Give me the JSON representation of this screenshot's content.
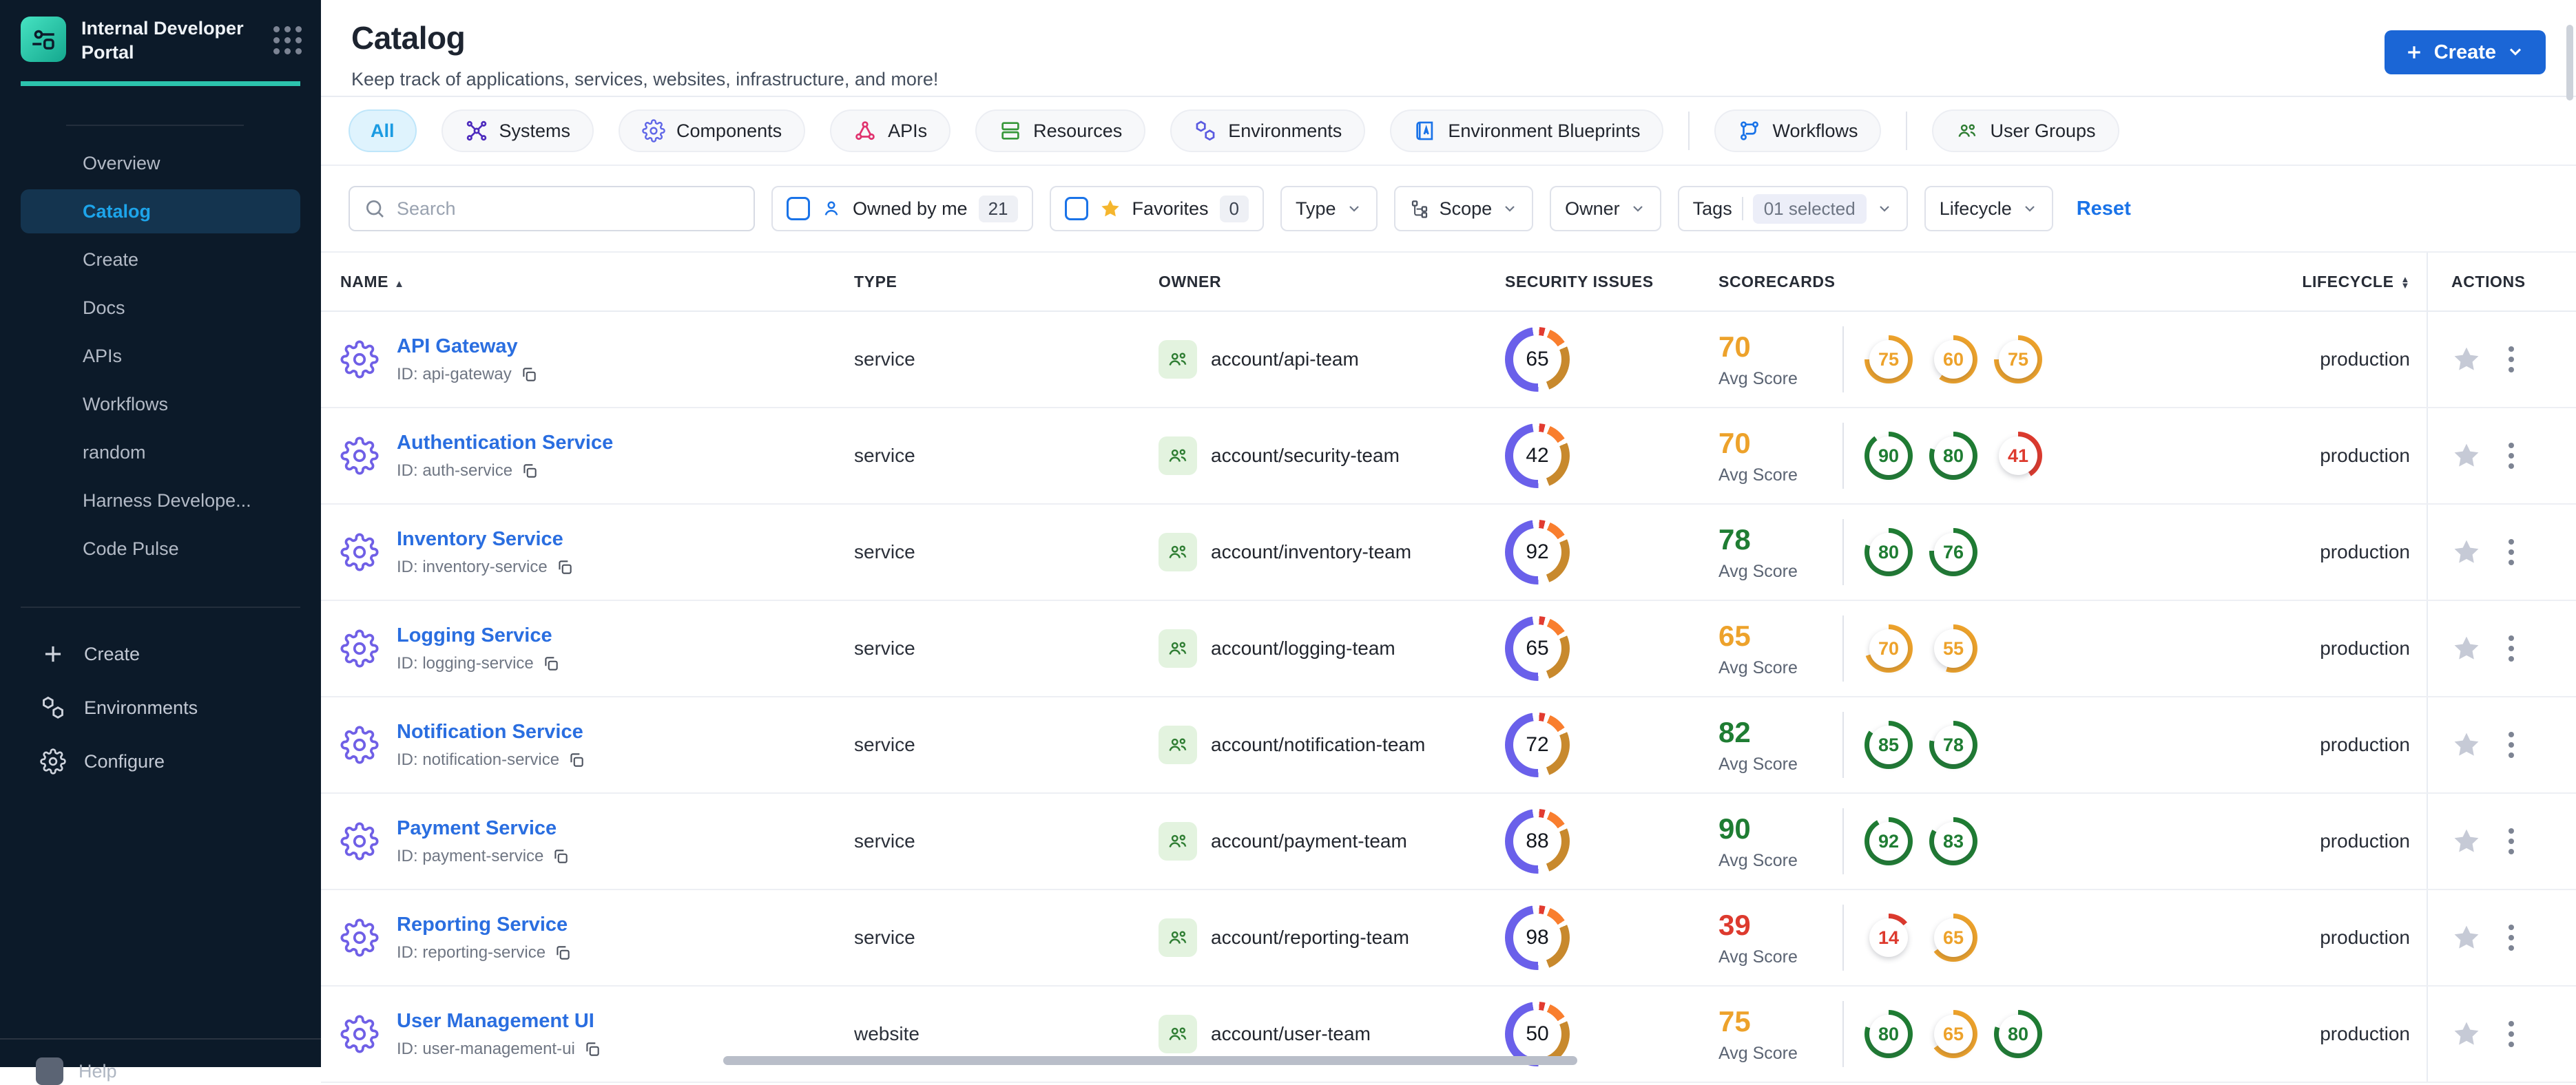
{
  "sidebar": {
    "logo_title": "Internal Developer Portal",
    "nav_items": [
      "Overview",
      "Catalog",
      "Create",
      "Docs",
      "APIs",
      "Workflows",
      "random",
      "Harness Develope...",
      "Code Pulse"
    ],
    "active_item": "Catalog",
    "secondary_items": {
      "create": "Create",
      "environments": "Environments",
      "configure": "Configure"
    },
    "footer_item": "Help"
  },
  "header": {
    "title": "Catalog",
    "subtitle": "Keep track of applications, services, websites, infrastructure, and more!",
    "create_button": "Create"
  },
  "tabs": [
    {
      "label": "All",
      "active": true
    },
    {
      "label": "Systems"
    },
    {
      "label": "Components"
    },
    {
      "label": "APIs"
    },
    {
      "label": "Resources"
    },
    {
      "label": "Environments"
    },
    {
      "label": "Environment Blueprints"
    },
    {
      "label": "Workflows"
    },
    {
      "label": "User Groups"
    }
  ],
  "filters": {
    "search_placeholder": "Search",
    "owned_by_me": {
      "label": "Owned by me",
      "count": "21"
    },
    "favorites": {
      "label": "Favorites",
      "count": "0"
    },
    "type": "Type",
    "scope": "Scope",
    "owner": "Owner",
    "tags_label": "Tags",
    "tags_value": "01 selected",
    "lifecycle": "Lifecycle",
    "reset": "Reset"
  },
  "status_colors": {
    "green": "#1f7d33",
    "orange": "#eda22b",
    "red": "#dd3a2e"
  },
  "table": {
    "columns": {
      "name": "NAME",
      "type": "TYPE",
      "owner": "OWNER",
      "security": "SECURITY ISSUES",
      "scorecards": "SCORECARDS",
      "lifecycle": "LIFECYCLE",
      "actions": "ACTIONS"
    },
    "avg_score_label": "Avg Score",
    "rows": [
      {
        "name": "API Gateway",
        "id": "ID: api-gateway",
        "type": "service",
        "owner": "account/api-team",
        "security_issues": 65,
        "avg_score": 70,
        "avg_color": "#eda22b",
        "scorecards": [
          {
            "value": 75,
            "color": "#eda22b"
          },
          {
            "value": 60,
            "color": "#eda22b"
          },
          {
            "value": 75,
            "color": "#eda22b"
          }
        ],
        "lifecycle": "production"
      },
      {
        "name": "Authentication Service",
        "id": "ID: auth-service",
        "type": "service",
        "owner": "account/security-team",
        "security_issues": 42,
        "avg_score": 70,
        "avg_color": "#eda22b",
        "scorecards": [
          {
            "value": 90,
            "color": "#1f7d33"
          },
          {
            "value": 80,
            "color": "#1f7d33"
          },
          {
            "value": 41,
            "color": "#dd3a2e"
          }
        ],
        "lifecycle": "production"
      },
      {
        "name": "Inventory Service",
        "id": "ID: inventory-service",
        "type": "service",
        "owner": "account/inventory-team",
        "security_issues": 92,
        "avg_score": 78,
        "avg_color": "#1f7d33",
        "scorecards": [
          {
            "value": 80,
            "color": "#1f7d33"
          },
          {
            "value": 76,
            "color": "#1f7d33"
          }
        ],
        "lifecycle": "production"
      },
      {
        "name": "Logging Service",
        "id": "ID: logging-service",
        "type": "service",
        "owner": "account/logging-team",
        "security_issues": 65,
        "avg_score": 65,
        "avg_color": "#eda22b",
        "scorecards": [
          {
            "value": 70,
            "color": "#eda22b"
          },
          {
            "value": 55,
            "color": "#eda22b"
          }
        ],
        "lifecycle": "production"
      },
      {
        "name": "Notification Service",
        "id": "ID: notification-service",
        "type": "service",
        "owner": "account/notification-team",
        "security_issues": 72,
        "avg_score": 82,
        "avg_color": "#1f7d33",
        "scorecards": [
          {
            "value": 85,
            "color": "#1f7d33"
          },
          {
            "value": 78,
            "color": "#1f7d33"
          }
        ],
        "lifecycle": "production"
      },
      {
        "name": "Payment Service",
        "id": "ID: payment-service",
        "type": "service",
        "owner": "account/payment-team",
        "security_issues": 88,
        "avg_score": 90,
        "avg_color": "#1f7d33",
        "scorecards": [
          {
            "value": 92,
            "color": "#1f7d33"
          },
          {
            "value": 83,
            "color": "#1f7d33"
          }
        ],
        "lifecycle": "production"
      },
      {
        "name": "Reporting Service",
        "id": "ID: reporting-service",
        "type": "service",
        "owner": "account/reporting-team",
        "security_issues": 98,
        "avg_score": 39,
        "avg_color": "#dd3a2e",
        "scorecards": [
          {
            "value": 14,
            "color": "#dd3a2e"
          },
          {
            "value": 65,
            "color": "#eda22b"
          }
        ],
        "lifecycle": "production"
      },
      {
        "name": "User Management UI",
        "id": "ID: user-management-ui",
        "type": "website",
        "owner": "account/user-team",
        "security_issues": 50,
        "avg_score": 75,
        "avg_color": "#eda22b",
        "scorecards": [
          {
            "value": 80,
            "color": "#1f7d33"
          },
          {
            "value": 65,
            "color": "#eda22b"
          },
          {
            "value": 80,
            "color": "#1f7d33"
          }
        ],
        "lifecycle": "production"
      }
    ]
  }
}
